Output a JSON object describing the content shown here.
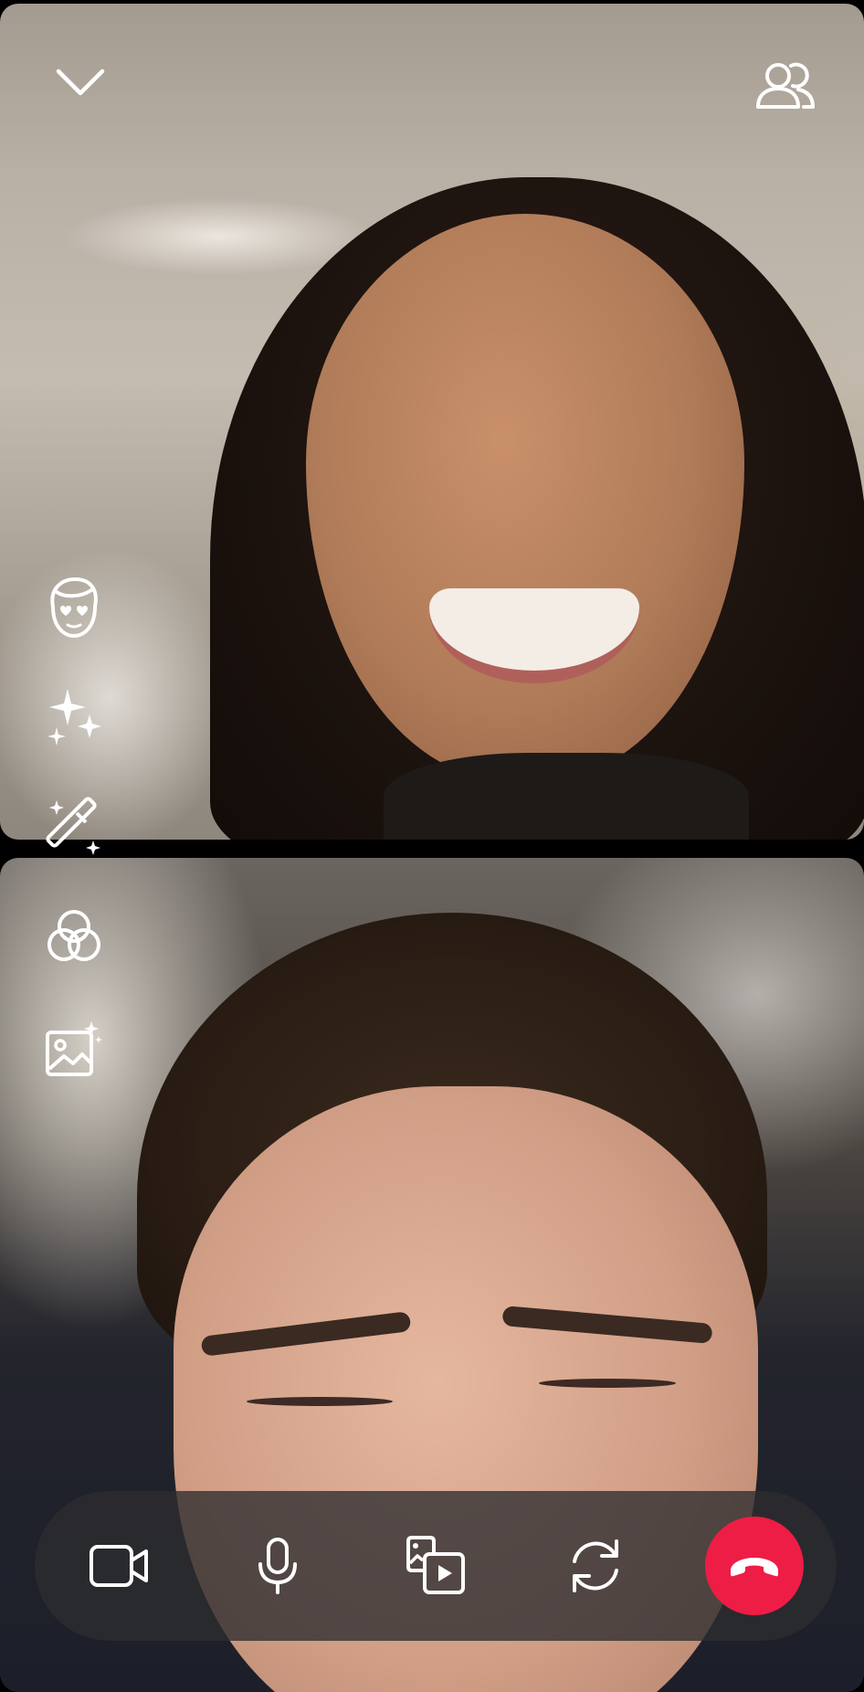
{
  "call": {
    "top_video": {
      "description_name": "remote-participant-video"
    },
    "bottom_video": {
      "description_name": "self-video"
    }
  },
  "top_bar": {
    "left_icon": "chevron-down-icon",
    "right_icon": "participants-icon"
  },
  "effects_rail": {
    "items": [
      {
        "icon": "avatar-face-icon"
      },
      {
        "icon": "sparkles-icon"
      },
      {
        "icon": "magic-wand-icon"
      },
      {
        "icon": "filter-circles-icon"
      },
      {
        "icon": "background-image-icon"
      }
    ]
  },
  "controls": {
    "items": [
      {
        "icon": "video-camera-icon"
      },
      {
        "icon": "microphone-icon"
      },
      {
        "icon": "share-media-icon"
      },
      {
        "icon": "flip-camera-icon"
      },
      {
        "icon": "end-call-icon"
      }
    ],
    "end_call_color": "#ee1d45",
    "bar_color": "#2d2d30"
  }
}
